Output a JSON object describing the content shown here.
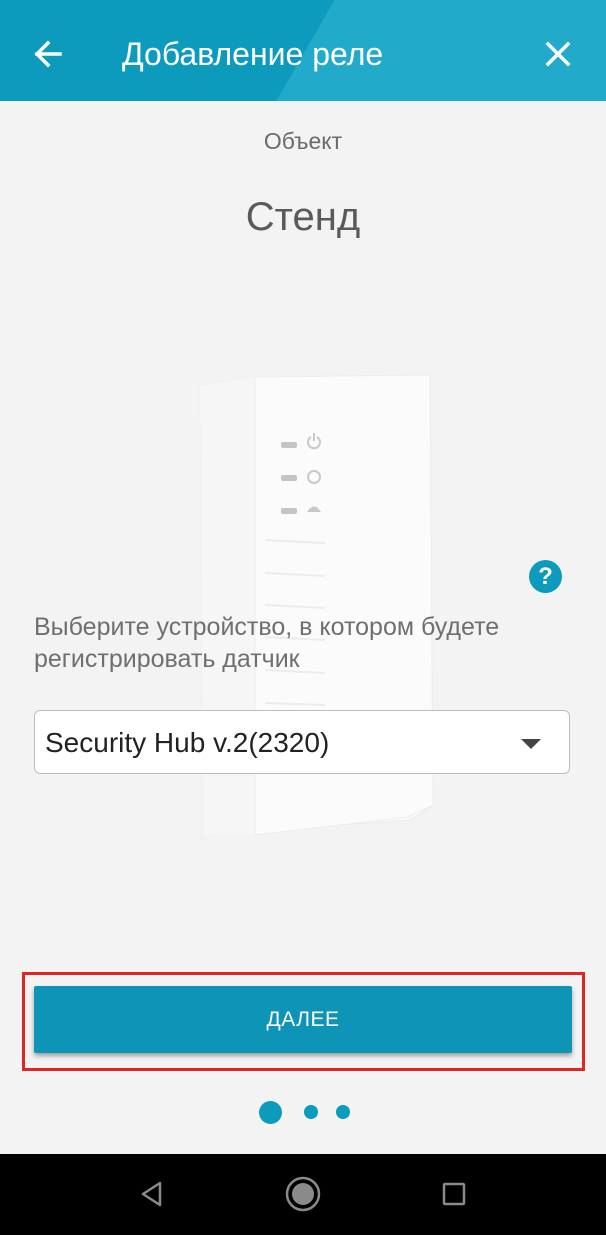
{
  "header": {
    "title": "Добавление реле",
    "back_icon": "arrow-left-icon",
    "close_icon": "close-icon"
  },
  "object": {
    "label": "Объект",
    "name": "Стенд"
  },
  "help": {
    "label": "?",
    "icon": "help-icon"
  },
  "device_prompt": "Выберите устройство, в котором будете регистрировать датчик",
  "device_select": {
    "value": "Security Hub v.2(2320)",
    "icon": "dropdown-arrow-icon"
  },
  "next_button": {
    "label": "ДАЛЕЕ"
  },
  "pagination": {
    "total": 3,
    "current": 1
  },
  "system_nav": {
    "icons": [
      "back-icon",
      "home-icon",
      "recents-icon"
    ]
  },
  "colors": {
    "primary": "#0d9bbd",
    "highlight": "#e0261d",
    "background": "#f3f3f3"
  }
}
